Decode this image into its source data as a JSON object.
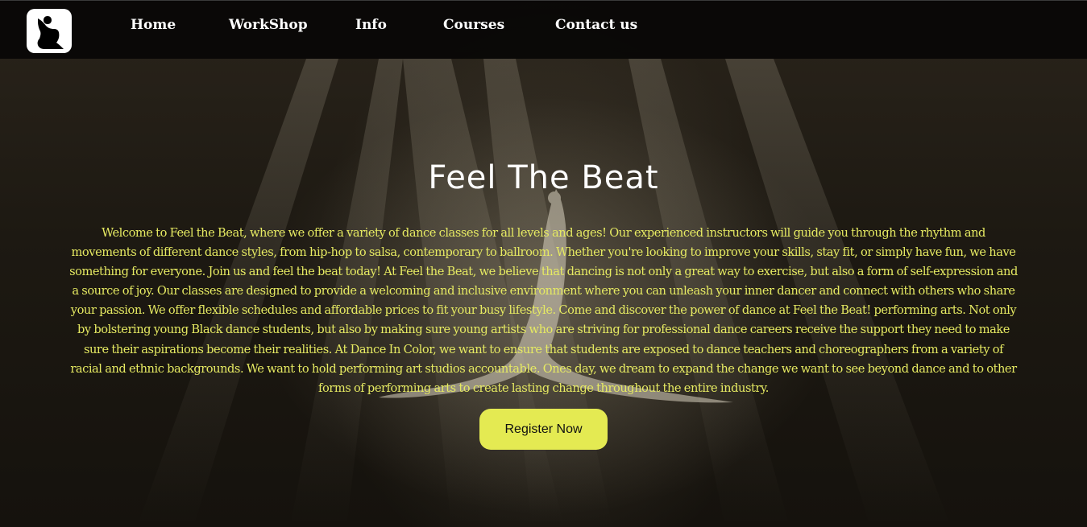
{
  "nav": {
    "logo": "dancer-logo-icon",
    "links": [
      "Home",
      "WorkShop",
      "Info",
      "Courses",
      "Contact us"
    ]
  },
  "hero": {
    "title": "Feel The Beat",
    "description": "Welcome to Feel the Beat, where we offer a variety of dance classes for all levels and ages! Our experienced instructors will guide you through the rhythm and movements of different dance styles, from hip-hop to salsa, contemporary to ballroom. Whether you're looking to improve your skills, stay fit, or simply have fun, we have something for everyone. Join us and feel the beat today! At Feel the Beat, we believe that dancing is not only a great way to exercise, but also a form of self-expression and a source of joy. Our classes are designed to provide a welcoming and inclusive environment where you can unleash your inner dancer and connect with others who share your passion. We offer flexible schedules and affordable prices to fit your busy lifestyle. Come and discover the power of dance at Feel the Beat! performing arts. Not only by bolstering young Black dance students, but also by making sure young artists who are striving for professional dance careers receive the support they need to make sure their aspirations become their realities. At Dance In Color, we want to ensure that students are exposed to dance teachers and choreographers from a variety of racial and ethnic backgrounds. We want to hold performing art studios accountable. Ones day, we dream to expand the change we want to see beyond dance and to other forms of performing arts to create lasting change throughout the entire industry.",
    "button_label": "Register Now"
  },
  "colors": {
    "accent": "#e4ea52",
    "text_highlight": "#e6ea62",
    "nav_bg": "#080705"
  }
}
